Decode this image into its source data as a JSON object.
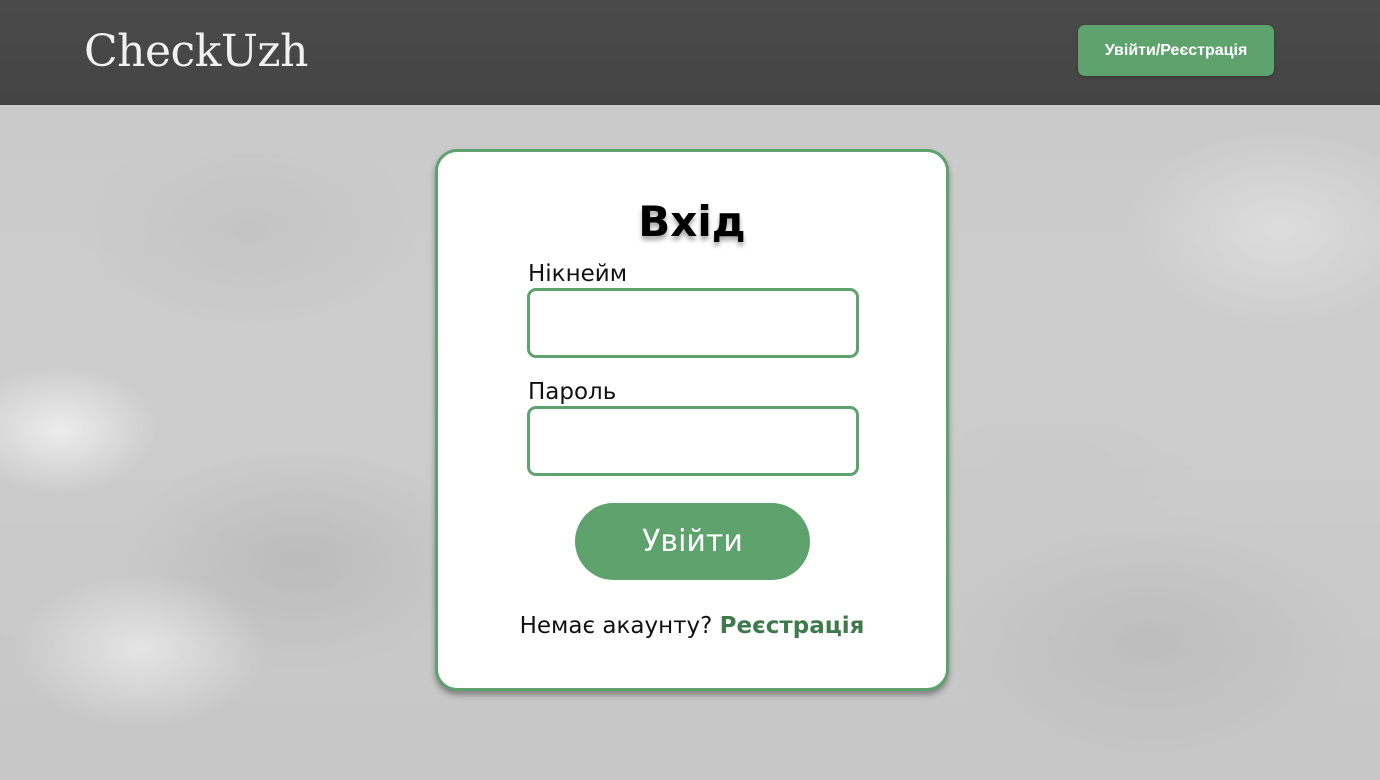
{
  "header": {
    "logo": "CheckUzh",
    "auth_button_label": "Увійти/Реєстрація"
  },
  "login_form": {
    "title": "Вхід",
    "nickname_label": "Нікнейм",
    "nickname_value": "",
    "password_label": "Пароль",
    "password_value": "",
    "submit_label": "Увійти",
    "no_account_text": "Немає акаунту?",
    "register_link_label": "Реєстрація"
  },
  "colors": {
    "accent": "#5ea26d",
    "header_bg": "#474747",
    "link": "#3f7a4c"
  }
}
